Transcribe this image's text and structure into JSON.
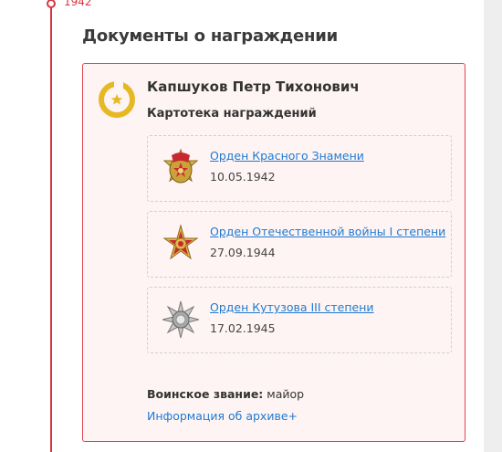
{
  "timeline": {
    "year": "1942"
  },
  "section": {
    "title": "Документы о награждении"
  },
  "document": {
    "person_name": "Капшуков Петр Тихонович",
    "card_type": "Картотека награждений",
    "awards": [
      {
        "name": "Орден Красного Знамени",
        "date": "10.05.1942",
        "icon": "order-red-banner-icon"
      },
      {
        "name": "Орден Отечественной войны I степени",
        "date": "27.09.1944",
        "icon": "order-patriotic-war-icon"
      },
      {
        "name": "Орден Кутузова III степени",
        "date": "17.02.1945",
        "icon": "order-kutuzov-icon"
      }
    ],
    "rank_label": "Воинское звание:",
    "rank_value": "майор",
    "archive_link": "Информация об архиве+"
  },
  "colors": {
    "accent": "#d6363f",
    "link": "#1f7ad1",
    "box_bg": "#fff4f4",
    "gold": "#e5b824"
  }
}
